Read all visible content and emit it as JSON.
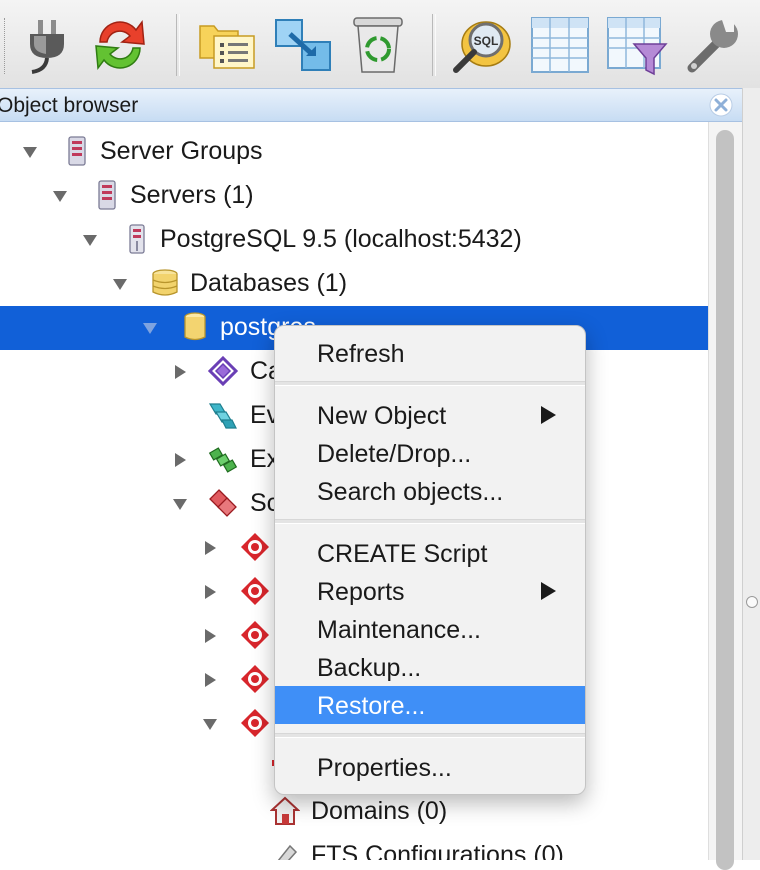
{
  "toolbar": {
    "buttons": [
      {
        "name": "connect-plug-icon"
      },
      {
        "name": "refresh-icon"
      },
      {
        "name": "properties-folder-icon"
      },
      {
        "name": "create-object-icon"
      },
      {
        "name": "delete-recycle-icon"
      },
      {
        "name": "sql-query-icon"
      },
      {
        "name": "view-data-table-icon"
      },
      {
        "name": "view-filtered-data-icon"
      },
      {
        "name": "tools-wrench-icon"
      }
    ]
  },
  "panel": {
    "title": "Object browser"
  },
  "tree": {
    "server_groups": "Server Groups",
    "servers": "Servers (1)",
    "postgres_server": "PostgreSQL 9.5 (localhost:5432)",
    "databases": "Databases (1)",
    "postgres_db": "postgres",
    "catalogs": "Ca",
    "event_triggers": "Ev",
    "extensions": "Ex",
    "schemas": "Sc",
    "domains": "Domains (0)",
    "fts_configurations": "FTS Configurations (0)"
  },
  "context_menu": {
    "refresh": "Refresh",
    "new_object": "New Object",
    "delete_drop": "Delete/Drop...",
    "search_objects": "Search objects...",
    "create_script": "CREATE Script",
    "reports": "Reports",
    "maintenance": "Maintenance...",
    "backup": "Backup...",
    "restore": "Restore...",
    "properties": "Properties..."
  },
  "colors": {
    "selection": "#1160d8",
    "menu_highlight": "#3f8ff7",
    "schema_red": "#d8262c"
  }
}
